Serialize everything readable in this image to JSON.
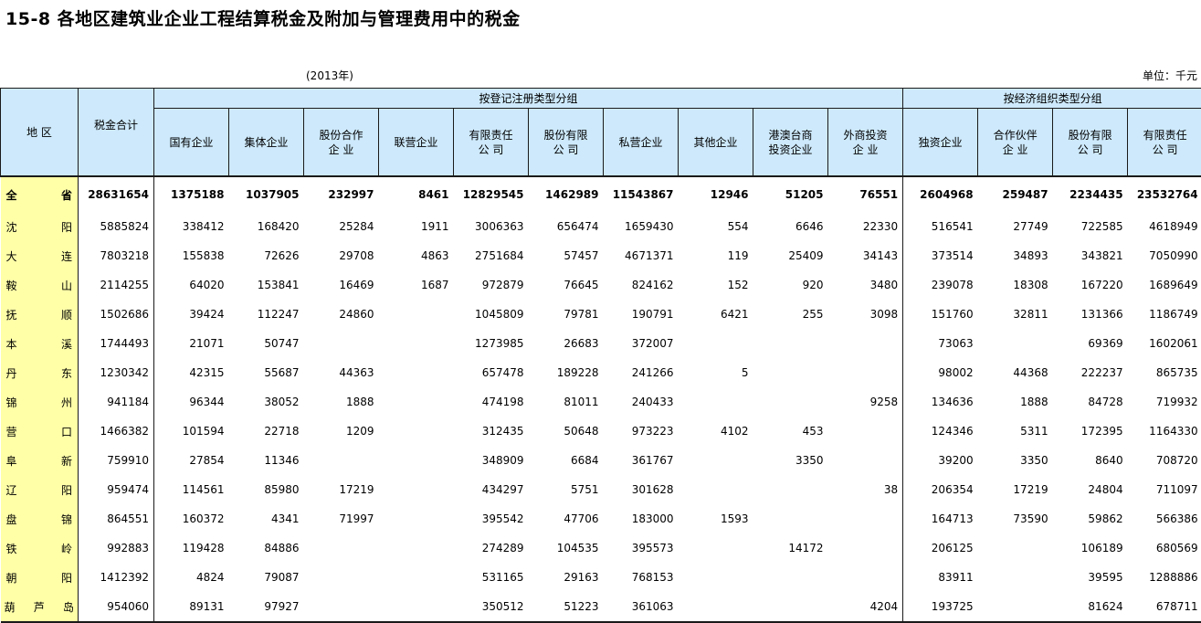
{
  "title": "15-8  各地区建筑业企业工程结算税金及附加与管理费用中的税金",
  "year": "(2013年)",
  "unit": "单位：千元",
  "headers": {
    "region": "地  区",
    "total": "税金合计",
    "group1": "按登记注册类型分组",
    "group2": "按经济组织类型分组",
    "cols": [
      [
        "国有企业"
      ],
      [
        "集体企业"
      ],
      [
        "股份合作",
        "企  业"
      ],
      [
        "联营企业"
      ],
      [
        "有限责任",
        "公  司"
      ],
      [
        "股份有限",
        "公  司"
      ],
      [
        "私营企业"
      ],
      [
        "其他企业"
      ],
      [
        "港澳台商",
        "投资企业"
      ],
      [
        "外商投资",
        "企  业"
      ],
      [
        "独资企业"
      ],
      [
        "合作伙伴",
        "企  业"
      ],
      [
        "股份有限",
        "公  司"
      ],
      [
        "有限责任",
        "公  司"
      ]
    ]
  },
  "rows": [
    {
      "region": "全省",
      "values": [
        "28631654",
        "1375188",
        "1037905",
        "232997",
        "8461",
        "12829545",
        "1462989",
        "11543867",
        "12946",
        "51205",
        "76551",
        "2604968",
        "259487",
        "2234435",
        "23532764"
      ]
    },
    {
      "region": "沈阳",
      "values": [
        "5885824",
        "338412",
        "168420",
        "25284",
        "1911",
        "3006363",
        "656474",
        "1659430",
        "554",
        "6646",
        "22330",
        "516541",
        "27749",
        "722585",
        "4618949"
      ]
    },
    {
      "region": "大连",
      "values": [
        "7803218",
        "155838",
        "72626",
        "29708",
        "4863",
        "2751684",
        "57457",
        "4671371",
        "119",
        "25409",
        "34143",
        "373514",
        "34893",
        "343821",
        "7050990"
      ]
    },
    {
      "region": "鞍山",
      "values": [
        "2114255",
        "64020",
        "153841",
        "16469",
        "1687",
        "972879",
        "76645",
        "824162",
        "152",
        "920",
        "3480",
        "239078",
        "18308",
        "167220",
        "1689649"
      ]
    },
    {
      "region": "抚顺",
      "values": [
        "1502686",
        "39424",
        "112247",
        "24860",
        "",
        "1045809",
        "79781",
        "190791",
        "6421",
        "255",
        "3098",
        "151760",
        "32811",
        "131366",
        "1186749"
      ]
    },
    {
      "region": "本溪",
      "values": [
        "1744493",
        "21071",
        "50747",
        "",
        "",
        "1273985",
        "26683",
        "372007",
        "",
        "",
        "",
        "73063",
        "",
        "69369",
        "1602061"
      ]
    },
    {
      "region": "丹东",
      "values": [
        "1230342",
        "42315",
        "55687",
        "44363",
        "",
        "657478",
        "189228",
        "241266",
        "5",
        "",
        "",
        "98002",
        "44368",
        "222237",
        "865735"
      ]
    },
    {
      "region": "锦州",
      "values": [
        "941184",
        "96344",
        "38052",
        "1888",
        "",
        "474198",
        "81011",
        "240433",
        "",
        "",
        "9258",
        "134636",
        "1888",
        "84728",
        "719932"
      ]
    },
    {
      "region": "营口",
      "values": [
        "1466382",
        "101594",
        "22718",
        "1209",
        "",
        "312435",
        "50648",
        "973223",
        "4102",
        "453",
        "",
        "124346",
        "5311",
        "172395",
        "1164330"
      ]
    },
    {
      "region": "阜新",
      "values": [
        "759910",
        "27854",
        "11346",
        "",
        "",
        "348909",
        "6684",
        "361767",
        "",
        "3350",
        "",
        "39200",
        "3350",
        "8640",
        "708720"
      ]
    },
    {
      "region": "辽阳",
      "values": [
        "959474",
        "114561",
        "85980",
        "17219",
        "",
        "434297",
        "5751",
        "301628",
        "",
        "",
        "38",
        "206354",
        "17219",
        "24804",
        "711097"
      ]
    },
    {
      "region": "盘锦",
      "values": [
        "864551",
        "160372",
        "4341",
        "71997",
        "",
        "395542",
        "47706",
        "183000",
        "1593",
        "",
        "",
        "164713",
        "73590",
        "59862",
        "566386"
      ]
    },
    {
      "region": "铁岭",
      "values": [
        "992883",
        "119428",
        "84886",
        "",
        "",
        "274289",
        "104535",
        "395573",
        "",
        "14172",
        "",
        "206125",
        "",
        "106189",
        "680569"
      ]
    },
    {
      "region": "朝阳",
      "values": [
        "1412392",
        "4824",
        "79087",
        "",
        "",
        "531165",
        "29163",
        "768153",
        "",
        "",
        "",
        "83911",
        "",
        "39595",
        "1288886"
      ]
    },
    {
      "region": "葫芦岛",
      "values": [
        "954060",
        "89131",
        "97927",
        "",
        "",
        "350512",
        "51223",
        "361063",
        "",
        "",
        "4204",
        "193725",
        "",
        "81624",
        "678711"
      ]
    }
  ]
}
